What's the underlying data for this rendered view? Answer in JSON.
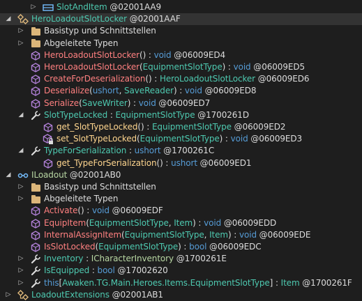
{
  "colors": {
    "background": "#1e1e1e",
    "selected_row": "#333333",
    "type_name": "#4ec9b0",
    "method_name": "#ff8080",
    "property_name": "#ffd68f",
    "keyword": "#569cd6",
    "plain_text": "#dcdcdc",
    "method_icon": "#b180d7",
    "class_icon": "#dcb67a",
    "interface_icon": "#75beff",
    "wrench_icon": "#dcdcdc"
  },
  "rows": [
    {
      "level": 3,
      "expander": "collapsed",
      "icon": "struct-icon",
      "selected": false,
      "parts": [
        {
          "t": "SlotAndItem",
          "c": "c-type"
        },
        {
          "t": " @02001AA9",
          "c": "c-plain"
        }
      ]
    },
    {
      "level": 1,
      "expander": "expanded",
      "icon": "class-icon",
      "selected": true,
      "parts": [
        {
          "t": "HeroLoadoutSlotLocker",
          "c": "c-type"
        },
        {
          "t": " @02001AAF",
          "c": "c-plain"
        }
      ]
    },
    {
      "level": 2,
      "expander": "collapsed",
      "icon": "folder-icon",
      "selected": false,
      "parts": [
        {
          "t": "Basistyp und Schnittstellen",
          "c": "c-plain"
        }
      ]
    },
    {
      "level": 2,
      "expander": "collapsed",
      "icon": "folder-icon",
      "selected": false,
      "parts": [
        {
          "t": "Abgeleitete Typen",
          "c": "c-plain"
        }
      ]
    },
    {
      "level": 2,
      "expander": "none",
      "icon": "method-icon",
      "selected": false,
      "parts": [
        {
          "t": "HeroLoadoutSlotLocker",
          "c": "c-method"
        },
        {
          "t": "() : ",
          "c": "c-plain"
        },
        {
          "t": "void",
          "c": "c-kw"
        },
        {
          "t": " @06009ED4",
          "c": "c-plain"
        }
      ]
    },
    {
      "level": 2,
      "expander": "none",
      "icon": "method-icon",
      "selected": false,
      "parts": [
        {
          "t": "HeroLoadoutSlotLocker",
          "c": "c-method"
        },
        {
          "t": "(",
          "c": "c-plain"
        },
        {
          "t": "EquipmentSlotType",
          "c": "c-type"
        },
        {
          "t": ") : ",
          "c": "c-plain"
        },
        {
          "t": "void",
          "c": "c-kw"
        },
        {
          "t": " @06009ED5",
          "c": "c-plain"
        }
      ]
    },
    {
      "level": 2,
      "expander": "none",
      "icon": "method-icon",
      "selected": false,
      "parts": [
        {
          "t": "CreateForDeserialization",
          "c": "c-method"
        },
        {
          "t": "() : ",
          "c": "c-plain"
        },
        {
          "t": "HeroLoadoutSlotLocker",
          "c": "c-type"
        },
        {
          "t": " @06009ED6",
          "c": "c-plain"
        }
      ]
    },
    {
      "level": 2,
      "expander": "none",
      "icon": "method-icon",
      "selected": false,
      "parts": [
        {
          "t": "Deserialize",
          "c": "c-method"
        },
        {
          "t": "(",
          "c": "c-plain"
        },
        {
          "t": "ushort",
          "c": "c-kw"
        },
        {
          "t": ", ",
          "c": "c-plain"
        },
        {
          "t": "SaveReader",
          "c": "c-type"
        },
        {
          "t": ") : ",
          "c": "c-plain"
        },
        {
          "t": "void",
          "c": "c-kw"
        },
        {
          "t": " @06009ED8",
          "c": "c-plain"
        }
      ]
    },
    {
      "level": 2,
      "expander": "none",
      "icon": "method-icon",
      "selected": false,
      "parts": [
        {
          "t": "Serialize",
          "c": "c-method"
        },
        {
          "t": "(",
          "c": "c-plain"
        },
        {
          "t": "SaveWriter",
          "c": "c-type"
        },
        {
          "t": ") : ",
          "c": "c-plain"
        },
        {
          "t": "void",
          "c": "c-kw"
        },
        {
          "t": " @06009ED7",
          "c": "c-plain"
        }
      ]
    },
    {
      "level": 2,
      "expander": "expanded",
      "icon": "wrench-icon",
      "selected": false,
      "parts": [
        {
          "t": "SlotTypeLocked",
          "c": "c-type"
        },
        {
          "t": " : ",
          "c": "c-plain"
        },
        {
          "t": "EquipmentSlotType",
          "c": "c-type"
        },
        {
          "t": " @1700261D",
          "c": "c-plain"
        }
      ]
    },
    {
      "level": 3,
      "expander": "none",
      "icon": "method-icon",
      "selected": false,
      "parts": [
        {
          "t": "get_SlotTypeLocked",
          "c": "c-prop"
        },
        {
          "t": "() : ",
          "c": "c-plain"
        },
        {
          "t": "EquipmentSlotType",
          "c": "c-type"
        },
        {
          "t": " @06009ED2",
          "c": "c-plain"
        }
      ]
    },
    {
      "level": 3,
      "expander": "none",
      "icon": "method-lock-icon",
      "selected": false,
      "parts": [
        {
          "t": "set_SlotTypeLocked",
          "c": "c-prop"
        },
        {
          "t": "(",
          "c": "c-plain"
        },
        {
          "t": "EquipmentSlotType",
          "c": "c-type"
        },
        {
          "t": ") : ",
          "c": "c-plain"
        },
        {
          "t": "void",
          "c": "c-kw"
        },
        {
          "t": " @06009ED3",
          "c": "c-plain"
        }
      ]
    },
    {
      "level": 2,
      "expander": "expanded",
      "icon": "wrench-icon",
      "selected": false,
      "parts": [
        {
          "t": "TypeForSerialization",
          "c": "c-type"
        },
        {
          "t": " : ",
          "c": "c-plain"
        },
        {
          "t": "ushort",
          "c": "c-kw"
        },
        {
          "t": " @1700261C",
          "c": "c-plain"
        }
      ]
    },
    {
      "level": 3,
      "expander": "none",
      "icon": "method-icon",
      "selected": false,
      "parts": [
        {
          "t": "get_TypeForSerialization",
          "c": "c-prop"
        },
        {
          "t": "() : ",
          "c": "c-plain"
        },
        {
          "t": "ushort",
          "c": "c-kw"
        },
        {
          "t": " @06009ED1",
          "c": "c-plain"
        }
      ]
    },
    {
      "level": 1,
      "expander": "expanded",
      "icon": "interface-icon",
      "selected": false,
      "parts": [
        {
          "t": "ILoadout",
          "c": "c-iface"
        },
        {
          "t": " @02001AB0",
          "c": "c-plain"
        }
      ]
    },
    {
      "level": 2,
      "expander": "collapsed",
      "icon": "folder-icon",
      "selected": false,
      "parts": [
        {
          "t": "Basistyp und Schnittstellen",
          "c": "c-plain"
        }
      ]
    },
    {
      "level": 2,
      "expander": "collapsed",
      "icon": "folder-icon",
      "selected": false,
      "parts": [
        {
          "t": "Abgeleitete Typen",
          "c": "c-plain"
        }
      ]
    },
    {
      "level": 2,
      "expander": "none",
      "icon": "method-icon",
      "selected": false,
      "parts": [
        {
          "t": "Activate",
          "c": "c-method"
        },
        {
          "t": "() : ",
          "c": "c-plain"
        },
        {
          "t": "void",
          "c": "c-kw"
        },
        {
          "t": " @06009EDF",
          "c": "c-plain"
        }
      ]
    },
    {
      "level": 2,
      "expander": "none",
      "icon": "method-icon",
      "selected": false,
      "parts": [
        {
          "t": "EquipItem",
          "c": "c-method"
        },
        {
          "t": "(",
          "c": "c-plain"
        },
        {
          "t": "EquipmentSlotType",
          "c": "c-type"
        },
        {
          "t": ", ",
          "c": "c-plain"
        },
        {
          "t": "Item",
          "c": "c-type"
        },
        {
          "t": ") : ",
          "c": "c-plain"
        },
        {
          "t": "void",
          "c": "c-kw"
        },
        {
          "t": " @06009EDD",
          "c": "c-plain"
        }
      ]
    },
    {
      "level": 2,
      "expander": "none",
      "icon": "method-icon",
      "selected": false,
      "parts": [
        {
          "t": "InternalAssignItem",
          "c": "c-method"
        },
        {
          "t": "(",
          "c": "c-plain"
        },
        {
          "t": "EquipmentSlotType",
          "c": "c-type"
        },
        {
          "t": ", ",
          "c": "c-plain"
        },
        {
          "t": "Item",
          "c": "c-type"
        },
        {
          "t": ") : ",
          "c": "c-plain"
        },
        {
          "t": "void",
          "c": "c-kw"
        },
        {
          "t": " @06009EDE",
          "c": "c-plain"
        }
      ]
    },
    {
      "level": 2,
      "expander": "none",
      "icon": "method-icon",
      "selected": false,
      "parts": [
        {
          "t": "IsSlotLocked",
          "c": "c-method"
        },
        {
          "t": "(",
          "c": "c-plain"
        },
        {
          "t": "EquipmentSlotType",
          "c": "c-type"
        },
        {
          "t": ") : ",
          "c": "c-plain"
        },
        {
          "t": "bool",
          "c": "c-kw"
        },
        {
          "t": " @06009EDC",
          "c": "c-plain"
        }
      ]
    },
    {
      "level": 2,
      "expander": "collapsed",
      "icon": "wrench-icon",
      "selected": false,
      "parts": [
        {
          "t": "Inventory",
          "c": "c-type"
        },
        {
          "t": " : ",
          "c": "c-plain"
        },
        {
          "t": "ICharacterInventory",
          "c": "c-iface"
        },
        {
          "t": " @1700261E",
          "c": "c-plain"
        }
      ]
    },
    {
      "level": 2,
      "expander": "collapsed",
      "icon": "wrench-icon",
      "selected": false,
      "parts": [
        {
          "t": "IsEquipped",
          "c": "c-type"
        },
        {
          "t": " : ",
          "c": "c-plain"
        },
        {
          "t": "bool",
          "c": "c-kw"
        },
        {
          "t": " @17002620",
          "c": "c-plain"
        }
      ]
    },
    {
      "level": 2,
      "expander": "collapsed",
      "icon": "wrench-icon",
      "selected": false,
      "parts": [
        {
          "t": "this",
          "c": "c-kw"
        },
        {
          "t": "[",
          "c": "c-plain"
        },
        {
          "t": "Awaken.TG.Main.Heroes.Items.EquipmentSlotType",
          "c": "c-type"
        },
        {
          "t": "] : ",
          "c": "c-plain"
        },
        {
          "t": "Item",
          "c": "c-type"
        },
        {
          "t": " @1700261F",
          "c": "c-plain"
        }
      ]
    },
    {
      "level": 1,
      "expander": "collapsed",
      "icon": "class-icon",
      "selected": false,
      "parts": [
        {
          "t": "LoadoutExtensions",
          "c": "c-type"
        },
        {
          "t": " @02001AB1",
          "c": "c-plain"
        }
      ]
    }
  ]
}
